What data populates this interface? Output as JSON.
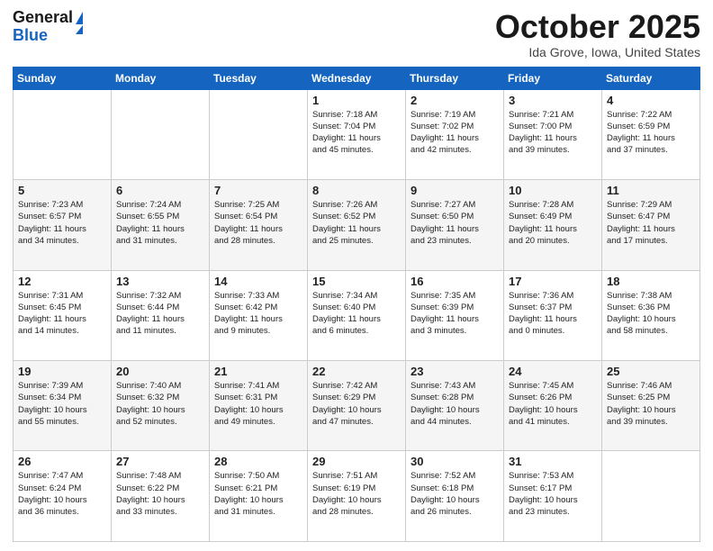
{
  "header": {
    "logo_line1": "General",
    "logo_line2": "Blue",
    "title": "October 2025",
    "location": "Ida Grove, Iowa, United States"
  },
  "days_of_week": [
    "Sunday",
    "Monday",
    "Tuesday",
    "Wednesday",
    "Thursday",
    "Friday",
    "Saturday"
  ],
  "weeks": [
    [
      {
        "num": "",
        "info": ""
      },
      {
        "num": "",
        "info": ""
      },
      {
        "num": "",
        "info": ""
      },
      {
        "num": "1",
        "info": "Sunrise: 7:18 AM\nSunset: 7:04 PM\nDaylight: 11 hours\nand 45 minutes."
      },
      {
        "num": "2",
        "info": "Sunrise: 7:19 AM\nSunset: 7:02 PM\nDaylight: 11 hours\nand 42 minutes."
      },
      {
        "num": "3",
        "info": "Sunrise: 7:21 AM\nSunset: 7:00 PM\nDaylight: 11 hours\nand 39 minutes."
      },
      {
        "num": "4",
        "info": "Sunrise: 7:22 AM\nSunset: 6:59 PM\nDaylight: 11 hours\nand 37 minutes."
      }
    ],
    [
      {
        "num": "5",
        "info": "Sunrise: 7:23 AM\nSunset: 6:57 PM\nDaylight: 11 hours\nand 34 minutes."
      },
      {
        "num": "6",
        "info": "Sunrise: 7:24 AM\nSunset: 6:55 PM\nDaylight: 11 hours\nand 31 minutes."
      },
      {
        "num": "7",
        "info": "Sunrise: 7:25 AM\nSunset: 6:54 PM\nDaylight: 11 hours\nand 28 minutes."
      },
      {
        "num": "8",
        "info": "Sunrise: 7:26 AM\nSunset: 6:52 PM\nDaylight: 11 hours\nand 25 minutes."
      },
      {
        "num": "9",
        "info": "Sunrise: 7:27 AM\nSunset: 6:50 PM\nDaylight: 11 hours\nand 23 minutes."
      },
      {
        "num": "10",
        "info": "Sunrise: 7:28 AM\nSunset: 6:49 PM\nDaylight: 11 hours\nand 20 minutes."
      },
      {
        "num": "11",
        "info": "Sunrise: 7:29 AM\nSunset: 6:47 PM\nDaylight: 11 hours\nand 17 minutes."
      }
    ],
    [
      {
        "num": "12",
        "info": "Sunrise: 7:31 AM\nSunset: 6:45 PM\nDaylight: 11 hours\nand 14 minutes."
      },
      {
        "num": "13",
        "info": "Sunrise: 7:32 AM\nSunset: 6:44 PM\nDaylight: 11 hours\nand 11 minutes."
      },
      {
        "num": "14",
        "info": "Sunrise: 7:33 AM\nSunset: 6:42 PM\nDaylight: 11 hours\nand 9 minutes."
      },
      {
        "num": "15",
        "info": "Sunrise: 7:34 AM\nSunset: 6:40 PM\nDaylight: 11 hours\nand 6 minutes."
      },
      {
        "num": "16",
        "info": "Sunrise: 7:35 AM\nSunset: 6:39 PM\nDaylight: 11 hours\nand 3 minutes."
      },
      {
        "num": "17",
        "info": "Sunrise: 7:36 AM\nSunset: 6:37 PM\nDaylight: 11 hours\nand 0 minutes."
      },
      {
        "num": "18",
        "info": "Sunrise: 7:38 AM\nSunset: 6:36 PM\nDaylight: 10 hours\nand 58 minutes."
      }
    ],
    [
      {
        "num": "19",
        "info": "Sunrise: 7:39 AM\nSunset: 6:34 PM\nDaylight: 10 hours\nand 55 minutes."
      },
      {
        "num": "20",
        "info": "Sunrise: 7:40 AM\nSunset: 6:32 PM\nDaylight: 10 hours\nand 52 minutes."
      },
      {
        "num": "21",
        "info": "Sunrise: 7:41 AM\nSunset: 6:31 PM\nDaylight: 10 hours\nand 49 minutes."
      },
      {
        "num": "22",
        "info": "Sunrise: 7:42 AM\nSunset: 6:29 PM\nDaylight: 10 hours\nand 47 minutes."
      },
      {
        "num": "23",
        "info": "Sunrise: 7:43 AM\nSunset: 6:28 PM\nDaylight: 10 hours\nand 44 minutes."
      },
      {
        "num": "24",
        "info": "Sunrise: 7:45 AM\nSunset: 6:26 PM\nDaylight: 10 hours\nand 41 minutes."
      },
      {
        "num": "25",
        "info": "Sunrise: 7:46 AM\nSunset: 6:25 PM\nDaylight: 10 hours\nand 39 minutes."
      }
    ],
    [
      {
        "num": "26",
        "info": "Sunrise: 7:47 AM\nSunset: 6:24 PM\nDaylight: 10 hours\nand 36 minutes."
      },
      {
        "num": "27",
        "info": "Sunrise: 7:48 AM\nSunset: 6:22 PM\nDaylight: 10 hours\nand 33 minutes."
      },
      {
        "num": "28",
        "info": "Sunrise: 7:50 AM\nSunset: 6:21 PM\nDaylight: 10 hours\nand 31 minutes."
      },
      {
        "num": "29",
        "info": "Sunrise: 7:51 AM\nSunset: 6:19 PM\nDaylight: 10 hours\nand 28 minutes."
      },
      {
        "num": "30",
        "info": "Sunrise: 7:52 AM\nSunset: 6:18 PM\nDaylight: 10 hours\nand 26 minutes."
      },
      {
        "num": "31",
        "info": "Sunrise: 7:53 AM\nSunset: 6:17 PM\nDaylight: 10 hours\nand 23 minutes."
      },
      {
        "num": "",
        "info": ""
      }
    ]
  ]
}
